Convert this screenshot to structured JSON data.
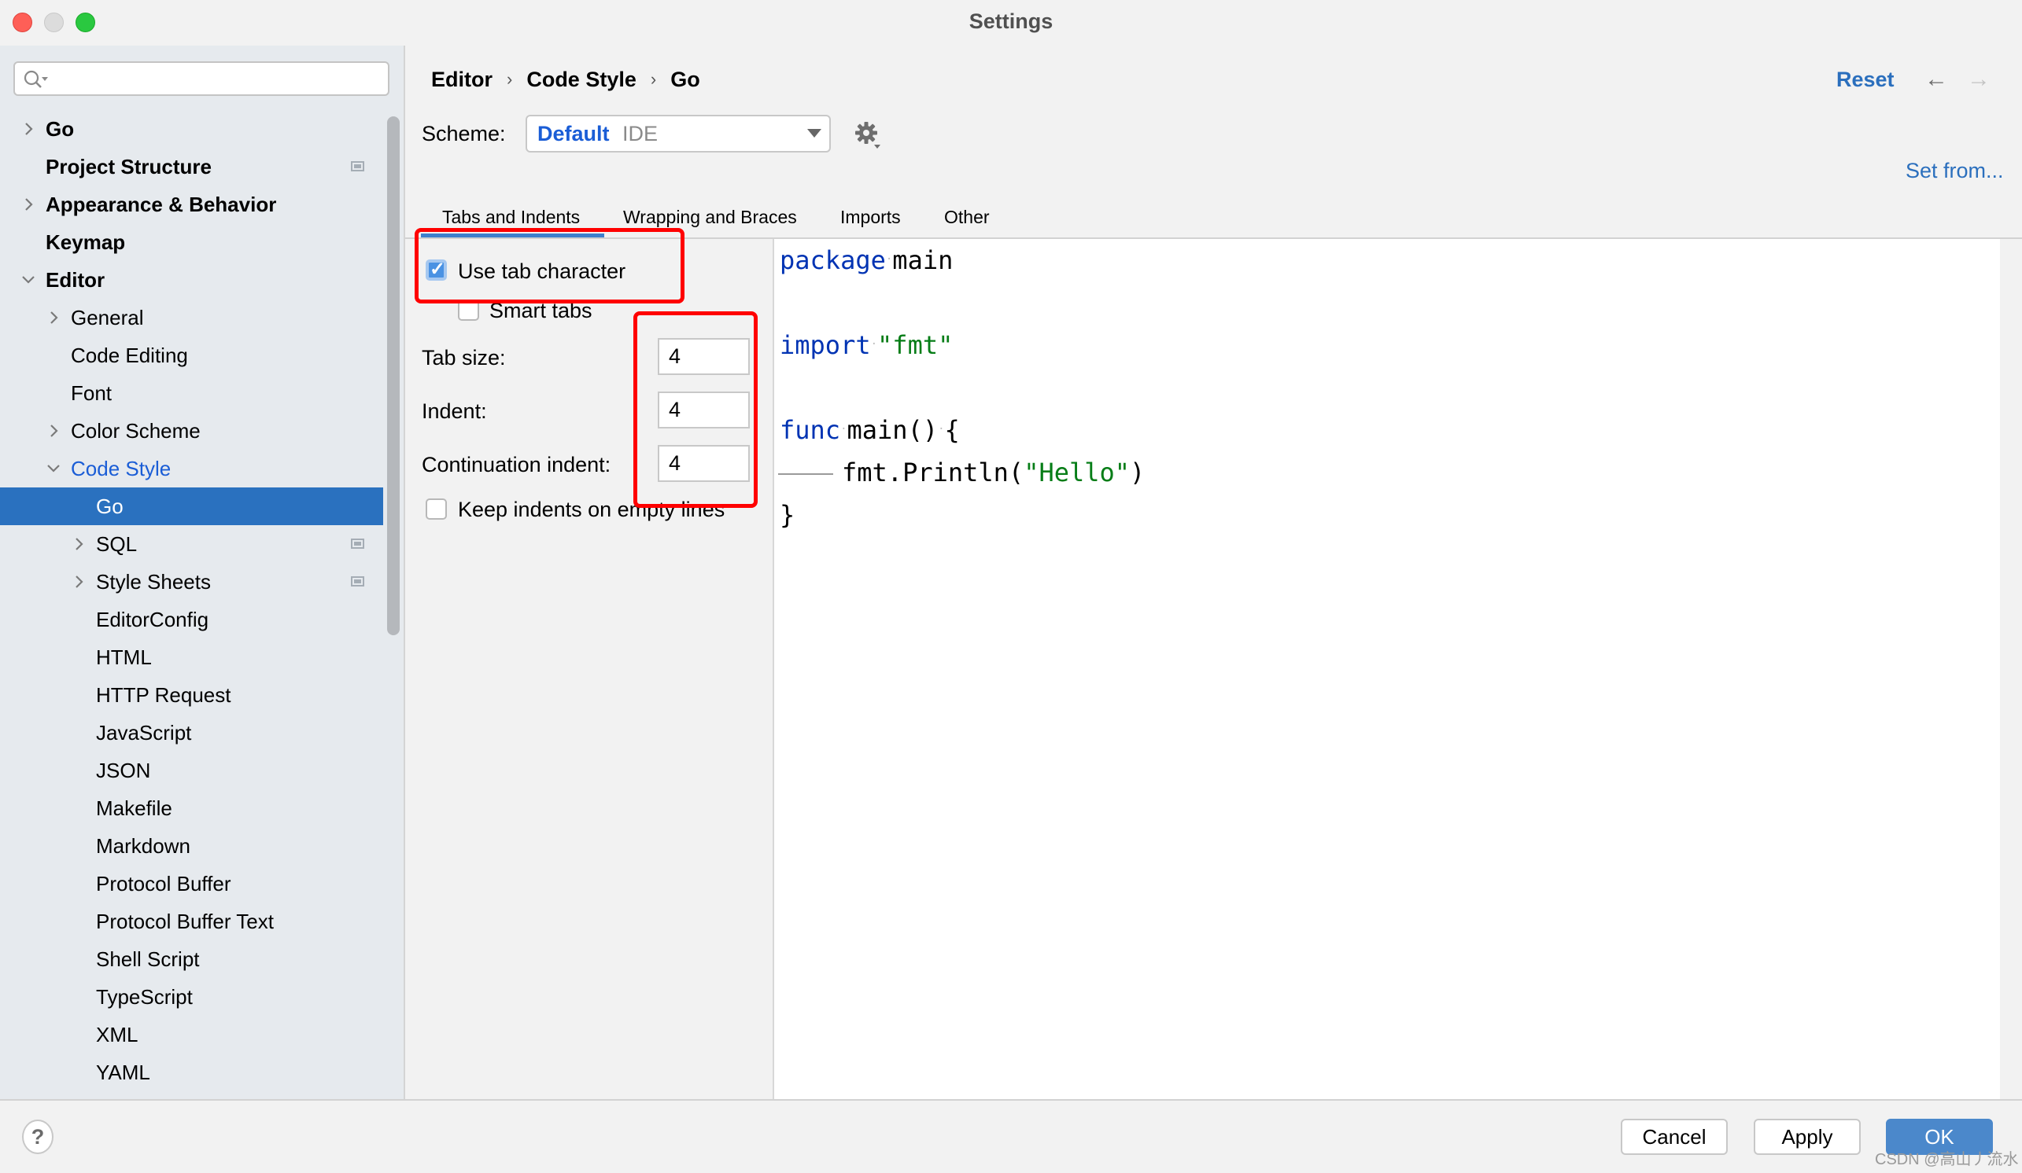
{
  "window": {
    "title": "Settings"
  },
  "sidebar": {
    "search_placeholder": "",
    "items": [
      {
        "label": "Go",
        "level": 0,
        "bold": true,
        "chevron": "right",
        "badge": false
      },
      {
        "label": "Project Structure",
        "level": 0,
        "bold": true,
        "chevron": "",
        "badge": true
      },
      {
        "label": "Appearance & Behavior",
        "level": 0,
        "bold": true,
        "chevron": "right",
        "badge": false
      },
      {
        "label": "Keymap",
        "level": 0,
        "bold": true,
        "chevron": "",
        "badge": false
      },
      {
        "label": "Editor",
        "level": 0,
        "bold": true,
        "chevron": "down",
        "badge": false
      },
      {
        "label": "General",
        "level": 1,
        "bold": false,
        "chevron": "right",
        "badge": false
      },
      {
        "label": "Code Editing",
        "level": 1,
        "bold": false,
        "chevron": "",
        "badge": false
      },
      {
        "label": "Font",
        "level": 1,
        "bold": false,
        "chevron": "",
        "badge": false
      },
      {
        "label": "Color Scheme",
        "level": 1,
        "bold": false,
        "chevron": "right",
        "badge": false
      },
      {
        "label": "Code Style",
        "level": 1,
        "bold": false,
        "chevron": "down",
        "badge": false,
        "active": true
      },
      {
        "label": "Go",
        "level": 2,
        "bold": false,
        "chevron": "",
        "badge": false,
        "selected": true
      },
      {
        "label": "SQL",
        "level": 2,
        "bold": false,
        "chevron": "right",
        "badge": true
      },
      {
        "label": "Style Sheets",
        "level": 2,
        "bold": false,
        "chevron": "right",
        "badge": true
      },
      {
        "label": "EditorConfig",
        "level": 2,
        "bold": false,
        "chevron": "",
        "badge": false
      },
      {
        "label": "HTML",
        "level": 2,
        "bold": false,
        "chevron": "",
        "badge": false
      },
      {
        "label": "HTTP Request",
        "level": 2,
        "bold": false,
        "chevron": "",
        "badge": false
      },
      {
        "label": "JavaScript",
        "level": 2,
        "bold": false,
        "chevron": "",
        "badge": false
      },
      {
        "label": "JSON",
        "level": 2,
        "bold": false,
        "chevron": "",
        "badge": false
      },
      {
        "label": "Makefile",
        "level": 2,
        "bold": false,
        "chevron": "",
        "badge": false
      },
      {
        "label": "Markdown",
        "level": 2,
        "bold": false,
        "chevron": "",
        "badge": false
      },
      {
        "label": "Protocol Buffer",
        "level": 2,
        "bold": false,
        "chevron": "",
        "badge": false
      },
      {
        "label": "Protocol Buffer Text",
        "level": 2,
        "bold": false,
        "chevron": "",
        "badge": false
      },
      {
        "label": "Shell Script",
        "level": 2,
        "bold": false,
        "chevron": "",
        "badge": false
      },
      {
        "label": "TypeScript",
        "level": 2,
        "bold": false,
        "chevron": "",
        "badge": false
      },
      {
        "label": "XML",
        "level": 2,
        "bold": false,
        "chevron": "",
        "badge": false
      },
      {
        "label": "YAML",
        "level": 2,
        "bold": false,
        "chevron": "",
        "badge": false
      }
    ]
  },
  "header": {
    "breadcrumb": [
      "Editor",
      "Code Style",
      "Go"
    ],
    "breadcrumb_separator": "›",
    "reset_label": "Reset",
    "back_icon": "←",
    "forward_icon": "→"
  },
  "scheme": {
    "label": "Scheme:",
    "selected_name": "Default",
    "selected_type": "IDE",
    "set_from_label": "Set from..."
  },
  "tabs": [
    {
      "label": "Tabs and Indents",
      "active": true
    },
    {
      "label": "Wrapping and Braces",
      "active": false
    },
    {
      "label": "Imports",
      "active": false
    },
    {
      "label": "Other",
      "active": false
    }
  ],
  "options": {
    "use_tab_character": {
      "label": "Use tab character",
      "checked": true
    },
    "smart_tabs": {
      "label": "Smart tabs",
      "checked": false
    },
    "tab_size": {
      "label": "Tab size:",
      "value": "4"
    },
    "indent": {
      "label": "Indent:",
      "value": "4"
    },
    "continuation_indent": {
      "label": "Continuation indent:",
      "value": "4"
    },
    "keep_indents": {
      "label": "Keep indents on empty lines",
      "checked": false
    }
  },
  "code_preview": {
    "line1_kw": "package",
    "line1_rest": "main",
    "line2_kw": "import",
    "line2_str": "\"fmt\"",
    "line3_kw": "func",
    "line3_rest": "main()",
    "line3_brace": "{",
    "line4_a": "fmt.Println(",
    "line4_str": "\"Hello\"",
    "line4_b": ")",
    "line5": "}",
    "whitespace_dot": "·"
  },
  "footer": {
    "help_label": "?",
    "cancel_label": "Cancel",
    "apply_label": "Apply",
    "ok_label": "OK"
  },
  "watermark": "CSDN @高山丿流水",
  "colors": {
    "accent": "#2a71bf",
    "link": "#2b6fbd",
    "keyword": "#0033b3",
    "string": "#067d17",
    "annotation_red": "#ff0000"
  }
}
